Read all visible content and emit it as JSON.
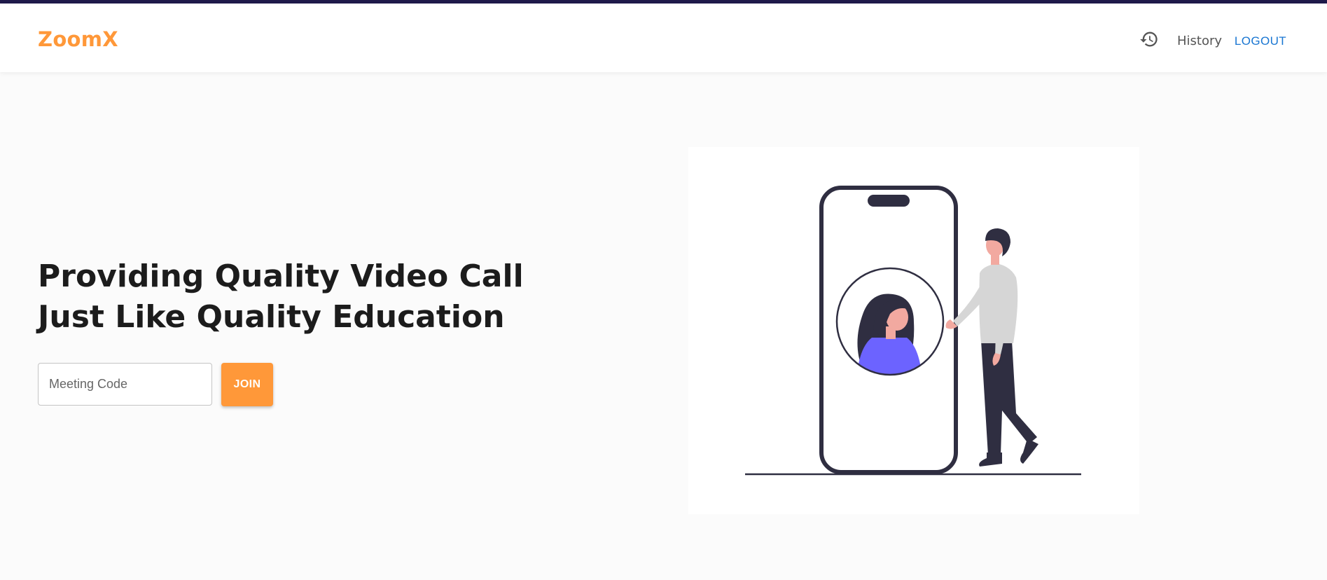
{
  "app": {
    "brand": "ZoomX"
  },
  "nav": {
    "history_icon": "history-icon",
    "history_label": "History",
    "logout_label": "LOGOUT"
  },
  "hero": {
    "headline": "Providing Quality Video Call Just Like Quality Education",
    "meeting_code": {
      "value": "",
      "placeholder": "Meeting Code"
    },
    "join_label": "JOIN"
  },
  "illustration": {
    "description_icon": "video-call-illustration"
  },
  "colors": {
    "brand": "#ff9839",
    "link": "#1976d2",
    "dark": "#2f2e41",
    "accent_purple": "#6c63ff",
    "skin": "#f2a9a0",
    "shirt_gray": "#d6d6d6"
  }
}
